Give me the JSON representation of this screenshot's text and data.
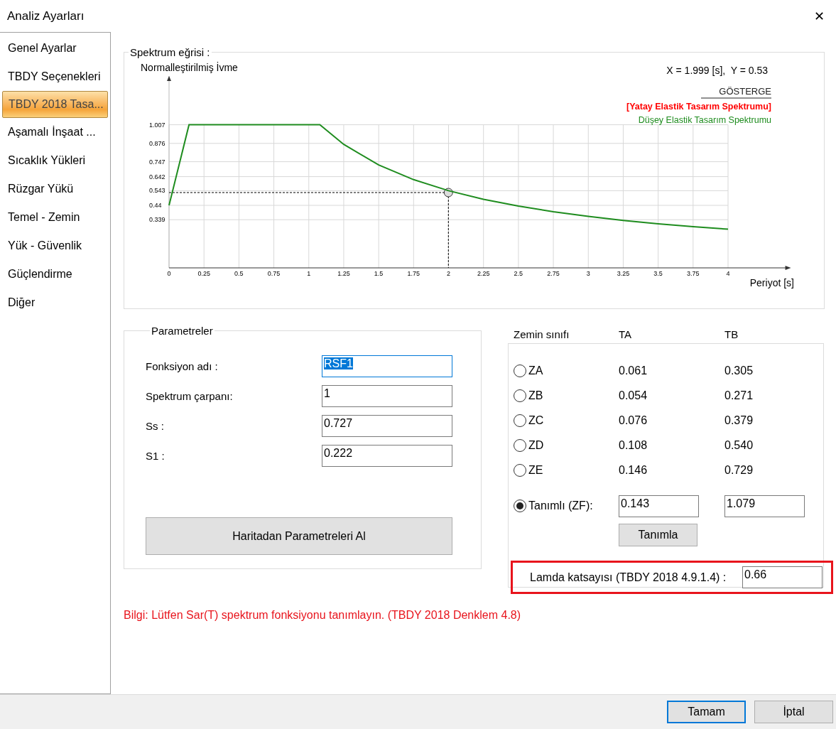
{
  "window": {
    "title": "Analiz Ayarları",
    "close": "✕"
  },
  "sidebar": {
    "items": [
      {
        "label": "Genel Ayarlar",
        "selected": false
      },
      {
        "label": "TBDY Seçenekleri",
        "selected": false
      },
      {
        "label": "TBDY 2018 Tasa...",
        "selected": true
      },
      {
        "label": "Aşamalı İnşaat ...",
        "selected": false
      },
      {
        "label": "Sıcaklık Yükleri",
        "selected": false
      },
      {
        "label": "Rüzgar Yükü",
        "selected": false
      },
      {
        "label": "Temel - Zemin",
        "selected": false
      },
      {
        "label": "Yük - Güvenlik",
        "selected": false
      },
      {
        "label": "Güçlendirme",
        "selected": false
      },
      {
        "label": "Diğer",
        "selected": false
      }
    ]
  },
  "spectrum": {
    "title": "Spektrum eğrisi :",
    "readout": "X = 1.999 [s],  Y = 0.53",
    "legend": {
      "title": "GÖSTERGE",
      "items": [
        {
          "label": "[Yatay Elastik Tasarım Spektrumu]",
          "color": "#ff0000",
          "selected": true
        },
        {
          "label": "Düşey Elastik Tasarım Spektrumu",
          "color": "#1e8c1e",
          "selected": false
        }
      ]
    },
    "chart_data": {
      "type": "line",
      "xlabel": "Periyot [s]",
      "ylabel": "Normalleştirilmiş İvme",
      "x": [
        0,
        0.143,
        0.5,
        1,
        1.079,
        1.25,
        1.5,
        1.75,
        2,
        2.25,
        2.5,
        2.75,
        3,
        3.25,
        3.5,
        3.75,
        4
      ],
      "series": [
        {
          "color": "#1e8c1e",
          "values": [
            0.44,
            1.007,
            1.007,
            1.007,
            1.007,
            0.869,
            0.724,
            0.621,
            0.543,
            0.483,
            0.435,
            0.395,
            0.362,
            0.334,
            0.31,
            0.29,
            0.272
          ]
        }
      ],
      "xlim": [
        0,
        4.45
      ],
      "ylim": [
        0,
        1.35
      ],
      "grid": true,
      "xticks": [
        0,
        0.25,
        0.5,
        0.75,
        1,
        1.25,
        1.5,
        1.75,
        2,
        2.25,
        2.5,
        2.75,
        3,
        3.25,
        3.5,
        3.75,
        4
      ],
      "yticks": [
        0.339,
        0.44,
        0.543,
        0.642,
        0.747,
        0.876,
        1.007
      ],
      "ref_lines": [
        {
          "axis": "x",
          "value": 1.999
        },
        {
          "axis": "y",
          "value": 0.53
        }
      ]
    }
  },
  "parameters": {
    "title": "Parametreler",
    "fields": [
      {
        "label": "Fonksiyon adı :",
        "value": "RSF1",
        "focused": true
      },
      {
        "label": "Spektrum çarpanı:",
        "value": "1",
        "focused": false
      },
      {
        "label": "Ss :",
        "value": "0.727",
        "focused": false
      },
      {
        "label": "S1 :",
        "value": "0.222",
        "focused": false
      }
    ],
    "map_button": "Haritadan Parametreleri Al"
  },
  "soil": {
    "columns": [
      "Zemin sınıfı",
      "TA",
      "TB"
    ],
    "classes": [
      {
        "kind": "preset",
        "label": "ZA",
        "ta": "0.061",
        "tb": "0.305",
        "selected": false
      },
      {
        "kind": "preset",
        "label": "ZB",
        "ta": "0.054",
        "tb": "0.271",
        "selected": false
      },
      {
        "kind": "preset",
        "label": "ZC",
        "ta": "0.076",
        "tb": "0.379",
        "selected": false
      },
      {
        "kind": "preset",
        "label": "ZD",
        "ta": "0.108",
        "tb": "0.540",
        "selected": false
      },
      {
        "kind": "preset",
        "label": "ZE",
        "ta": "0.146",
        "tb": "0.729",
        "selected": false
      },
      {
        "kind": "custom",
        "label": "Tanımlı (ZF):",
        "ta": "0.143",
        "tb": "1.079",
        "selected": true
      }
    ],
    "define_button": "Tanımla",
    "lambda": {
      "label": "Lamda katsayısı (TBDY 2018 4.9.1.4) :",
      "value": "0.66",
      "highlighted": true
    }
  },
  "info": "Bilgi: Lütfen Sar(T) spektrum fonksiyonu tanımlayın. (TBDY 2018 Denklem 4.8)",
  "buttons": [
    {
      "label": "Tamam",
      "default": true
    },
    {
      "label": "İptal",
      "default": false
    }
  ]
}
